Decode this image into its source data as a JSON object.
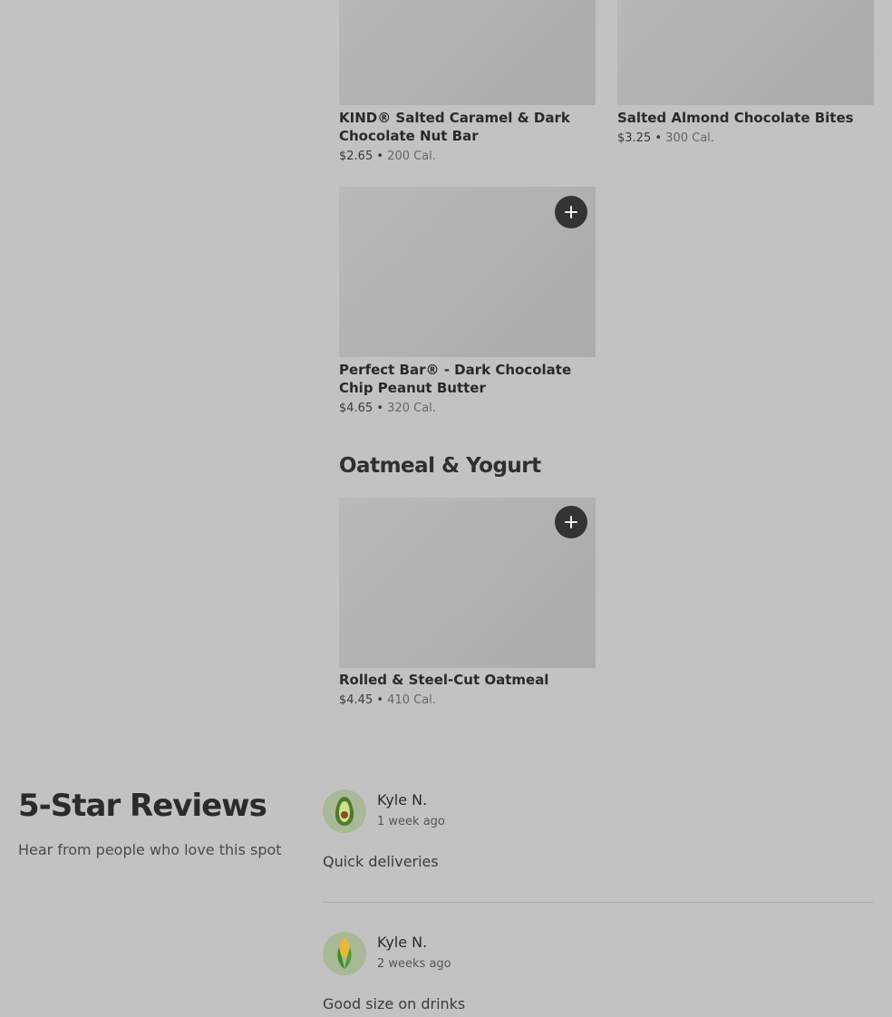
{
  "items": [
    {
      "name": "KIND® Salted Caramel & Dark Chocolate Nut Bar",
      "price": "$2.65",
      "sep": "•",
      "cal": "200 Cal."
    },
    {
      "name": "Salted Almond Chocolate Bites",
      "price": "$3.25",
      "sep": "•",
      "cal": "300 Cal."
    },
    {
      "name": "Perfect Bar® - Dark Chocolate Chip Peanut Butter",
      "price": "$4.65",
      "sep": "•",
      "cal": "320 Cal."
    },
    {
      "name": "Rolled & Steel-Cut Oatmeal",
      "price": "$4.45",
      "sep": "•",
      "cal": "410 Cal."
    }
  ],
  "sections": {
    "oatmeal_title": "Oatmeal & Yogurt"
  },
  "reviews": {
    "title": "5-Star Reviews",
    "subtitle": "Hear from people who love this spot",
    "list": [
      {
        "name": "Kyle N.",
        "time": "1 week ago",
        "text": "Quick deliveries",
        "avatar_icon": "avocado-icon"
      },
      {
        "name": "Kyle N.",
        "time": "2 weeks ago",
        "text": "Good size on drinks",
        "avatar_icon": "corn-icon"
      }
    ]
  },
  "colors": {
    "overlay_bg": "#c2c2c2",
    "add_button": "#333333"
  }
}
